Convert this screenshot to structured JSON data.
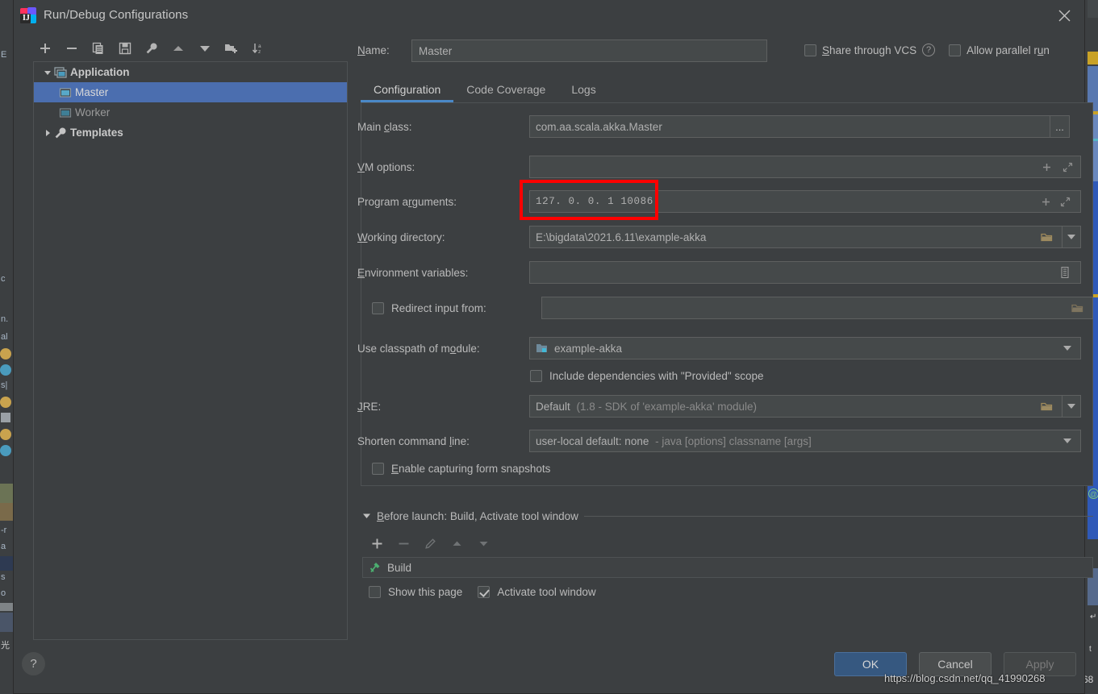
{
  "window": {
    "title": "Run/Debug Configurations",
    "app_icon": "intellij-idea-logo",
    "close_icon": "close-icon"
  },
  "tree_toolbar": {
    "buttons": [
      {
        "name": "add",
        "icon": "plus-icon"
      },
      {
        "name": "remove",
        "icon": "minus-icon"
      },
      {
        "name": "copy",
        "icon": "copy-icon"
      },
      {
        "name": "save",
        "icon": "save-icon"
      },
      {
        "name": "edit-templates",
        "icon": "wrench-icon"
      },
      {
        "name": "move-up",
        "icon": "arrow-up-icon"
      },
      {
        "name": "move-down",
        "icon": "arrow-down-icon"
      },
      {
        "name": "new-folder",
        "icon": "folder-plus-icon"
      },
      {
        "name": "sort",
        "icon": "sort-alphabetical-icon"
      }
    ]
  },
  "tree": {
    "nodes": [
      {
        "label": "Application",
        "level": 0,
        "expanded": true,
        "selected": false,
        "bold": true,
        "icon": "application-icon"
      },
      {
        "label": "Master",
        "level": 1,
        "expanded": null,
        "selected": true,
        "bold": false,
        "icon": "run-config-icon"
      },
      {
        "label": "Worker",
        "level": 1,
        "expanded": null,
        "selected": false,
        "bold": false,
        "icon": "run-config-icon"
      },
      {
        "label": "Templates",
        "level": 0,
        "expanded": false,
        "selected": false,
        "bold": true,
        "icon": "wrench-icon"
      }
    ]
  },
  "header": {
    "name_label": "Name:",
    "name_value": "Master",
    "share_label": "Share through VCS",
    "share_checked": false,
    "help_icon": "question-mark-icon",
    "parallel_label": "Allow parallel run",
    "parallel_checked": false
  },
  "tabs": [
    {
      "label": "Configuration",
      "active": true
    },
    {
      "label": "Code Coverage",
      "active": false
    },
    {
      "label": "Logs",
      "active": false
    }
  ],
  "configuration": {
    "main_class": {
      "label": "Main class:",
      "value": "com.aa.scala.akka.Master",
      "browse_label": "..."
    },
    "vm_options": {
      "label": "VM options:",
      "value": "",
      "macro_icon": "plus-icon",
      "expand_icon": "expand-icon"
    },
    "program_arguments": {
      "label": "Program arguments:",
      "value": "127. 0. 0. 1  10086",
      "macro_icon": "plus-icon",
      "expand_icon": "expand-icon",
      "highlighted": true,
      "highlight_color": "#ff0000"
    },
    "working_directory": {
      "label": "Working directory:",
      "value": "E:\\bigdata\\2021.6.11\\example-akka",
      "browse_icon": "folder-icon",
      "dropdown_icon": "chevron-down-icon"
    },
    "environment_variables": {
      "label": "Environment variables:",
      "value": "",
      "editor_icon": "list-editor-icon"
    },
    "redirect_input": {
      "label": "Redirect input from:",
      "checked": false,
      "value": "",
      "browse_icon": "folder-icon"
    },
    "use_classpath": {
      "label": "Use classpath of module:",
      "value": "example-akka",
      "module_icon": "module-icon",
      "dropdown_icon": "chevron-down-icon"
    },
    "include_provided": {
      "label": "Include dependencies with \"Provided\" scope",
      "checked": false
    },
    "jre": {
      "label": "JRE:",
      "value": "Default",
      "value_hint": "(1.8 - SDK of 'example-akka' module)",
      "browse_icon": "folder-icon",
      "dropdown_icon": "chevron-down-icon"
    },
    "shorten_command_line": {
      "label": "Shorten command line:",
      "value": "user-local default: none",
      "value_hint": "- java [options] classname [args]",
      "dropdown_icon": "chevron-down-icon"
    },
    "enable_snapshots": {
      "label": "Enable capturing form snapshots",
      "checked": false
    }
  },
  "before_launch": {
    "title": "Before launch: Build, Activate tool window",
    "collapse_icon": "triangle-down-icon",
    "toolbar": [
      {
        "name": "add",
        "icon": "plus-icon",
        "enabled": true
      },
      {
        "name": "remove",
        "icon": "minus-icon",
        "enabled": false
      },
      {
        "name": "edit",
        "icon": "pencil-icon",
        "enabled": false
      },
      {
        "name": "move-up",
        "icon": "arrow-up-icon",
        "enabled": false
      },
      {
        "name": "move-down",
        "icon": "arrow-down-icon",
        "enabled": false
      }
    ],
    "items": [
      {
        "label": "Build",
        "icon": "build-hammer-icon"
      }
    ],
    "show_this_page": {
      "label": "Show this page",
      "checked": false
    },
    "activate_tool_window": {
      "label": "Activate tool window",
      "checked": true
    }
  },
  "footer": {
    "help_label": "?",
    "ok_label": "OK",
    "cancel_label": "Cancel",
    "apply_label": "Apply",
    "apply_enabled": false
  },
  "watermark": "https://blog.csdn.net/qq_41990268",
  "background_strip": {
    "left_glyphs": [
      "E",
      "",
      "",
      "",
      "",
      "",
      "c",
      "",
      "n.",
      "al",
      "",
      "",
      "sp",
      "",
      "",
      "",
      "",
      "",
      "",
      "",
      "-r",
      "a",
      "",
      "s",
      "o",
      "",
      "",
      "",
      "",
      "",
      ""
    ]
  }
}
